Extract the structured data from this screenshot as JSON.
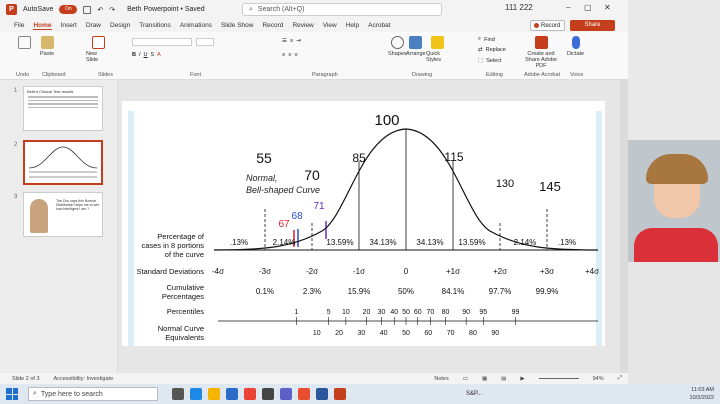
{
  "titlebar": {
    "autosave_label": "AutoSave",
    "autosave_state": "On",
    "doc_title": "Beth Powerpoint • Saved",
    "search_placeholder": "Search (Alt+Q)",
    "user_initials": "111 222"
  },
  "tabs": [
    "File",
    "Home",
    "Insert",
    "Draw",
    "Design",
    "Transitions",
    "Animations",
    "Slide Show",
    "Record",
    "Review",
    "View",
    "Help",
    "Acrobat"
  ],
  "active_tab": "Home",
  "record_label": "Record",
  "share_label": "Share",
  "ribbon": {
    "paste": "Paste",
    "new_slide": "New Slide",
    "undo_label": "Undo",
    "clipboard_label": "Clipboard",
    "slides_label": "Slides",
    "font_label": "Font",
    "paragraph_label": "Paragraph",
    "shapes": "Shapes",
    "arrange": "Arrange",
    "quick_styles": "Quick Styles",
    "drawing_label": "Drawing",
    "find": "Find",
    "replace": "Replace",
    "select": "Select",
    "editing_label": "Editing",
    "create_share_pdf": "Create and Share Adobe PDF",
    "adobe_label": "Adobe Acrobat",
    "dictate": "Dictate",
    "voice_label": "Voice"
  },
  "thumbnails": [
    {
      "num": "1",
      "title": "Beth's Clinical Test results"
    },
    {
      "num": "2",
      "title": ""
    },
    {
      "num": "3",
      "title": "The Doc says this Normal Distribution helps me to see how Intelligent I am ?"
    }
  ],
  "slide": {
    "handwritten_top": "100",
    "handwritten_numbers": [
      "55",
      "70",
      "85",
      "115",
      "130",
      "145"
    ],
    "handwritten_scores": [
      "67",
      "68",
      "71"
    ],
    "curve_label_line1": "Normal,",
    "curve_label_line2": "Bell-shaped Curve",
    "row_percentage_label_1": "Percentage of",
    "row_percentage_label_2": "cases in 8 portions",
    "row_percentage_label_3": "of the curve",
    "percentages": [
      ".13%",
      "2.14%",
      "13.59%",
      "34.13%",
      "34.13%",
      "13.59%",
      "2.14%",
      ".13%"
    ],
    "std_dev_label": "Standard Deviations",
    "std_devs": [
      "-4σ",
      "-3σ",
      "-2σ",
      "-1σ",
      "0",
      "+1σ",
      "+2σ",
      "+3σ",
      "+4σ"
    ],
    "cumulative_label_1": "Cumulative",
    "cumulative_label_2": "Percentages",
    "cumulative": [
      "0.1%",
      "2.3%",
      "15.9%",
      "50%",
      "84.1%",
      "97.7%",
      "99.9%"
    ],
    "percentiles_label": "Percentiles",
    "percentiles": [
      "1",
      "5",
      "10",
      "20",
      "30",
      "40",
      "50",
      "60",
      "70",
      "80",
      "90",
      "95",
      "99"
    ],
    "nce_label_1": "Normal Curve",
    "nce_label_2": "Equivalents",
    "nce": [
      "10",
      "20",
      "30",
      "40",
      "50",
      "60",
      "70",
      "80",
      "90"
    ]
  },
  "statusbar": {
    "slide_info": "Slide 2 of 3",
    "accessibility": "Accessibility: Investigate",
    "notes": "Notes",
    "zoom": "94%"
  },
  "taskbar": {
    "search_placeholder": "Type here to search",
    "stock": "S&P...",
    "time": "11:03 AM",
    "date": "10/3/2022"
  },
  "colors": {
    "accent": "#c43e1c",
    "handwritten_red": "#d9202a",
    "handwritten_blue": "#2a4fd6",
    "handwritten_purple": "#6a2bc9"
  }
}
